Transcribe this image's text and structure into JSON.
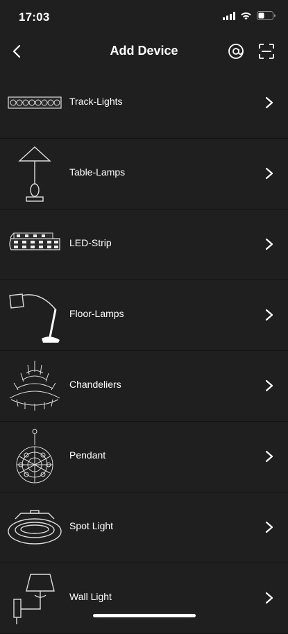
{
  "status_bar": {
    "time": "17:03",
    "icons": [
      "signal-icon",
      "wifi-icon",
      "battery-icon"
    ]
  },
  "nav": {
    "title": "Add Device",
    "back_icon": "chevron-left-icon",
    "actions": [
      "at-sign-icon",
      "scan-icon"
    ]
  },
  "devices": [
    {
      "label": "Track-Lights",
      "icon": "track-lights-icon"
    },
    {
      "label": "Table-Lamps",
      "icon": "table-lamp-icon"
    },
    {
      "label": "LED-Strip",
      "icon": "led-strip-icon"
    },
    {
      "label": "Floor-Lamps",
      "icon": "floor-lamp-icon"
    },
    {
      "label": "Chandeliers",
      "icon": "chandelier-icon"
    },
    {
      "label": "Pendant",
      "icon": "pendant-icon"
    },
    {
      "label": "Spot Light",
      "icon": "spot-light-icon"
    },
    {
      "label": "Wall Light",
      "icon": "wall-light-icon"
    }
  ],
  "colors": {
    "background": "#1f1f1f",
    "divider": "#121212",
    "text": "#ffffff"
  }
}
